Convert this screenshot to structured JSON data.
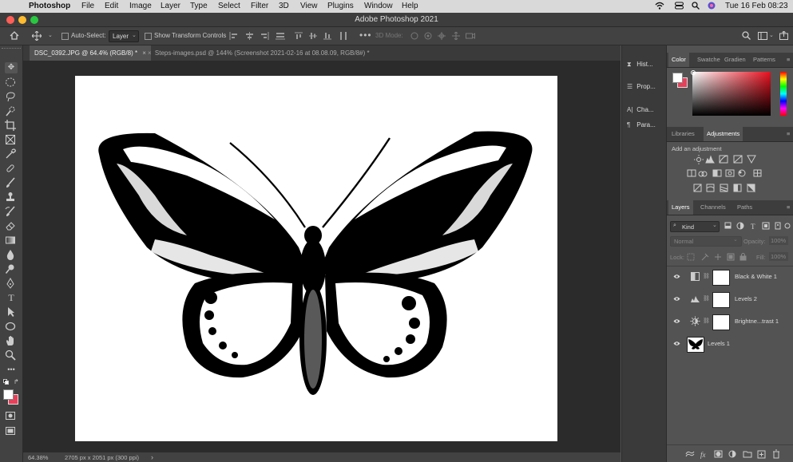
{
  "menubar": {
    "apple": "",
    "app": "Photoshop",
    "items": [
      "File",
      "Edit",
      "Image",
      "Layer",
      "Type",
      "Select",
      "Filter",
      "3D",
      "View",
      "Plugins",
      "Window",
      "Help"
    ],
    "clock": "Tue 16 Feb  08:23"
  },
  "title": "Adobe Photoshop 2021",
  "options": {
    "auto_select_label": "Auto-Select:",
    "auto_select_value": "Layer",
    "show_transform_label": "Show Transform Controls",
    "mode_3d_label": "3D Mode:"
  },
  "tabs": [
    {
      "label": "DSC_0392.JPG @ 64.4% (RGB/8) *",
      "active": true
    },
    {
      "label": "Steps-images.psd @ 144% (Screenshot 2021-02-16 at 08.08.09, RGB/8#) *",
      "active": false
    }
  ],
  "status": {
    "zoom": "64.38%",
    "info": "2705 px x 2051 px (300 ppi)",
    "arrow": "›"
  },
  "dock": [
    "Hist...",
    "Prop...",
    "Cha...",
    "Para..."
  ],
  "color_panel": {
    "tabs": [
      "Color",
      "Swatche",
      "Gradien",
      "Patterns"
    ],
    "fg": "#ffffff",
    "bg": "#e8405a"
  },
  "adjustments": {
    "tabs": [
      "Libraries",
      "Adjustments"
    ],
    "hint": "Add an adjustment"
  },
  "layers_panel": {
    "tabs": [
      "Layers",
      "Channels",
      "Paths"
    ],
    "filter": "Kind",
    "blend": "Normal",
    "opacity_label": "Opacity:",
    "opacity": "100%",
    "lock_label": "Lock:",
    "fill_label": "Fill:",
    "fill": "100%",
    "layers": [
      {
        "name": "Black & White 1",
        "icon": "black-white-adjustment-icon"
      },
      {
        "name": "Levels 2",
        "icon": "levels-adjustment-icon"
      },
      {
        "name": "Brightne...trast 1",
        "icon": "brightness-contrast-icon"
      },
      {
        "name": "Levels 1",
        "icon": "image-layer"
      }
    ]
  },
  "colors": {
    "accent_red": "#e8405a",
    "panel": "#535353",
    "canvas": "#2b2b2b"
  }
}
